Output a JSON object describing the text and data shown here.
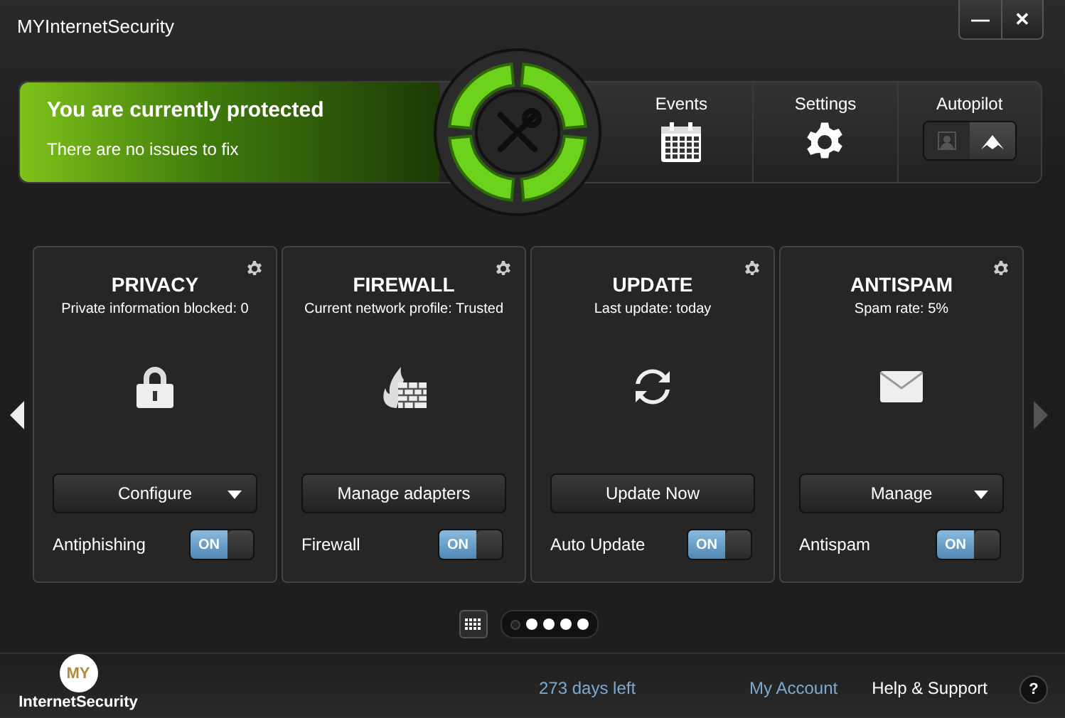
{
  "window": {
    "title": "MYInternetSecurity",
    "controls": [
      "—",
      "✕"
    ]
  },
  "status": {
    "headline": "You are currently protected",
    "message": "There are no issues to fix"
  },
  "nav": [
    {
      "label": "Events",
      "kind": "calendar"
    },
    {
      "label": "Settings",
      "kind": "gear"
    },
    {
      "label": "Autopilot",
      "kind": "autopilot",
      "on": true
    }
  ],
  "cards": [
    {
      "title": "PRIVACY",
      "subtitle": "Private information blocked: 0",
      "kind": "lock",
      "button": {
        "label": "Configure",
        "dropdown": true
      },
      "toggle": {
        "label": "Antiphishing",
        "state": "ON",
        "on": true
      }
    },
    {
      "title": "FIREWALL",
      "subtitle": "Current network profile: Trusted",
      "kind": "firewall",
      "button": {
        "label": "Manage adapters",
        "dropdown": false
      },
      "toggle": {
        "label": "Firewall",
        "state": "ON",
        "on": true
      }
    },
    {
      "title": "UPDATE",
      "subtitle": "Last update: today",
      "kind": "sync",
      "button": {
        "label": "Update Now",
        "dropdown": false
      },
      "toggle": {
        "label": "Auto Update",
        "state": "ON",
        "on": true
      }
    },
    {
      "title": "ANTISPAM",
      "subtitle": "Spam rate: 5%",
      "kind": "mail",
      "button": {
        "label": "Manage",
        "dropdown": true
      },
      "toggle": {
        "label": "Antispam",
        "state": "ON",
        "on": true
      }
    }
  ],
  "pages": [
    {
      "selected": true
    },
    {
      "selected": false
    },
    {
      "selected": false
    },
    {
      "selected": false
    },
    {
      "selected": false
    }
  ],
  "footer": {
    "logo_badge": "MY",
    "logo_text": "InternetSecurity",
    "days_left": "273 days left",
    "account": "My Account",
    "help": "Help & Support",
    "help_icon": "?"
  }
}
